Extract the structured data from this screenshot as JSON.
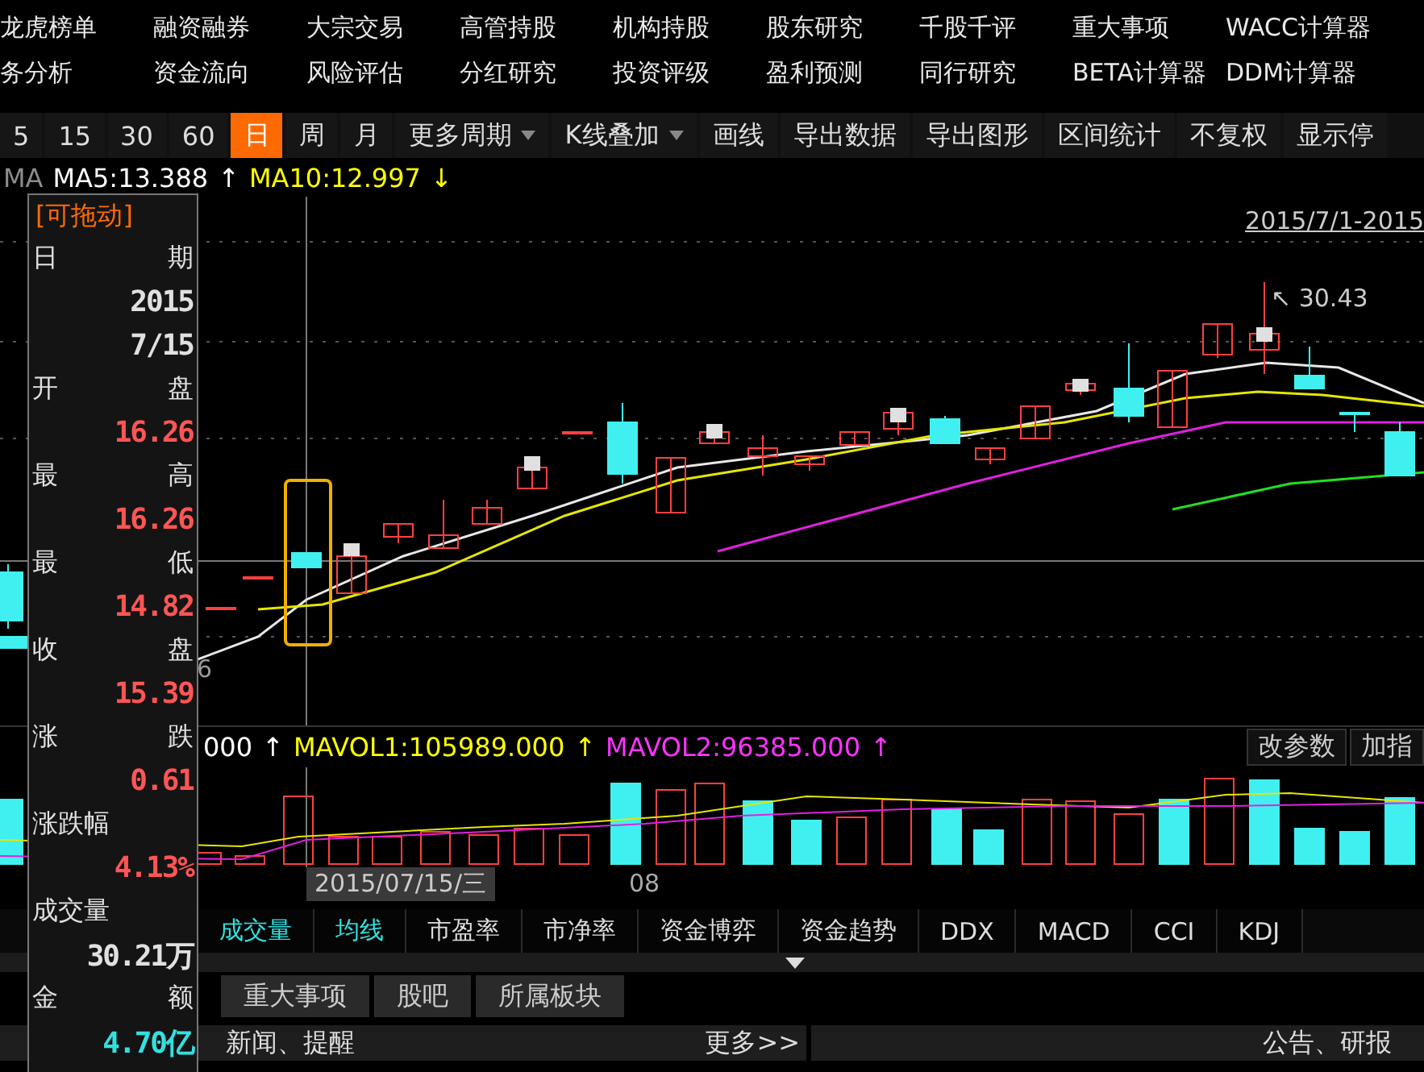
{
  "menu": {
    "rows": [
      [
        "龙虎榜单",
        "融资融券",
        "大宗交易",
        "高管持股",
        "机构持股",
        "股东研究",
        "千股千评",
        "重大事项",
        "WACC计算器"
      ],
      [
        "务分析",
        "资金流向",
        "风险评估",
        "分红研究",
        "投资评级",
        "盈利预测",
        "同行研究",
        "BETA计算器",
        "DDM计算器"
      ]
    ]
  },
  "toolbar": {
    "items": [
      {
        "label": "5",
        "kind": "button",
        "selected": false
      },
      {
        "label": "15",
        "kind": "button",
        "selected": false
      },
      {
        "label": "30",
        "kind": "button",
        "selected": false
      },
      {
        "label": "60",
        "kind": "button",
        "selected": false
      },
      {
        "label": "日",
        "kind": "button",
        "selected": true
      },
      {
        "label": "周",
        "kind": "button",
        "selected": false
      },
      {
        "label": "月",
        "kind": "button",
        "selected": false
      },
      {
        "label": "更多周期",
        "kind": "dropdown",
        "selected": false
      },
      {
        "label": "K线叠加",
        "kind": "dropdown",
        "selected": false
      },
      {
        "label": "画线",
        "kind": "button",
        "selected": false
      },
      {
        "label": "导出数据",
        "kind": "button",
        "selected": false
      },
      {
        "label": "导出图形",
        "kind": "button",
        "selected": false
      },
      {
        "label": "区间统计",
        "kind": "button",
        "selected": false
      },
      {
        "label": "不复权",
        "kind": "button",
        "selected": false
      },
      {
        "label": "显示停",
        "kind": "button",
        "selected": false
      }
    ]
  },
  "ma_legend": [
    {
      "text": "MA",
      "color": "#8c8c8c"
    },
    {
      "text": "MA5:13.388",
      "color": "#ffffff",
      "arrow": "↑"
    },
    {
      "text": "MA10:12.997",
      "color": "#ffff00",
      "arrow": "↓"
    }
  ],
  "chart": {
    "range_label": "2015/7/1-2015",
    "high_label": "↖ 30.43",
    "side_label": "6"
  },
  "info_panel": {
    "title": "[可拖动]",
    "rows": [
      {
        "kind": "pair",
        "left": "日",
        "right": "期"
      },
      {
        "kind": "value",
        "text": "2015",
        "color": "#e0e0e0"
      },
      {
        "kind": "value",
        "text": "7/15",
        "color": "#e0e0e0"
      },
      {
        "kind": "pair",
        "left": "开",
        "right": "盘"
      },
      {
        "kind": "value",
        "text": "16.26",
        "color": "#ff5555"
      },
      {
        "kind": "pair",
        "left": "最",
        "right": "高"
      },
      {
        "kind": "value",
        "text": "16.26",
        "color": "#ff5555"
      },
      {
        "kind": "pair",
        "left": "最",
        "right": "低"
      },
      {
        "kind": "value",
        "text": "14.82",
        "color": "#ff5555"
      },
      {
        "kind": "pair",
        "left": "收",
        "right": "盘"
      },
      {
        "kind": "value",
        "text": "15.39",
        "color": "#ff5555"
      },
      {
        "kind": "pair",
        "left": "涨",
        "right": "跌"
      },
      {
        "kind": "value",
        "text": "0.61",
        "color": "#ff5555"
      },
      {
        "kind": "label",
        "text": "涨跌幅"
      },
      {
        "kind": "value",
        "text": "4.13%",
        "color": "#ff5555"
      },
      {
        "kind": "label",
        "text": "成交量"
      },
      {
        "kind": "value",
        "text": "30.21万",
        "color": "#e0e0e0"
      },
      {
        "kind": "pair",
        "left": "金",
        "right": "额"
      },
      {
        "kind": "value",
        "text": "4.70亿",
        "color": "#33e0e0"
      }
    ]
  },
  "volume": {
    "legend": [
      {
        "text": "000",
        "color": "#ffffff",
        "arrow": "↑"
      },
      {
        "text": "MAVOL1:105989.000",
        "color": "#ffff00",
        "arrow": "↑"
      },
      {
        "text": "MAVOL2:96385.000",
        "color": "#ff33ff",
        "arrow": "↑"
      }
    ],
    "buttons": [
      "改参数",
      "加指"
    ],
    "date_label": "2015/07/15/三",
    "axis_label": "08"
  },
  "indicator_tabs": [
    {
      "label": "成交量",
      "selected": true
    },
    {
      "label": "均线",
      "selected": true
    },
    {
      "label": "市盈率",
      "selected": false
    },
    {
      "label": "市净率",
      "selected": false
    },
    {
      "label": "资金博弈",
      "selected": false
    },
    {
      "label": "资金趋势",
      "selected": false
    },
    {
      "label": "DDX",
      "selected": false
    },
    {
      "label": "MACD",
      "selected": false
    },
    {
      "label": "CCI",
      "selected": false
    },
    {
      "label": "KDJ",
      "selected": false
    }
  ],
  "bottom_tabs": [
    "重大事项",
    "股吧",
    "所属板块"
  ],
  "news": {
    "left_title": "新闻、提醒",
    "more": "更多>>",
    "right_title": "公告、研报"
  }
}
